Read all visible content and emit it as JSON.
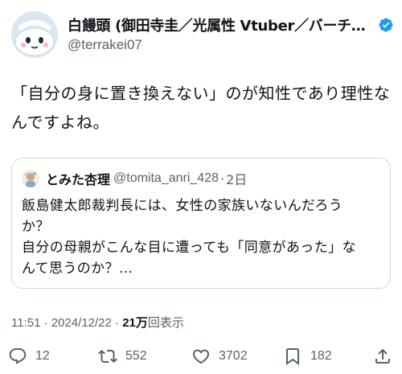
{
  "author": {
    "display_name": "白饅頭 (御田寺圭／光属性 Vtuber／バーチャ…",
    "handle": "@terrakei07",
    "verified_icon": "verified-badge-icon",
    "verified_color": "#1d9bf0"
  },
  "tweet": {
    "text_lines": [
      "「自分の身に置き換えない」のが知性であり理性な",
      "んですよね。"
    ]
  },
  "quote": {
    "display_name": "とみた杏理",
    "handle": "@tomita_anri_428",
    "separator": "·",
    "date": "2日",
    "text_lines": [
      "飯島健太郎裁判長には、女性の家族いないんだろう",
      "か？",
      "自分の母親がこんな目に遭っても「同意があった」な",
      "んて思うのか？..."
    ]
  },
  "meta": {
    "time": "11:51",
    "separator1": "·",
    "date": "2024/12/22",
    "separator2": "·",
    "views_count": "21万",
    "views_label": "回表示"
  },
  "actions": {
    "reply_count": "12",
    "retweet_count": "552",
    "like_count": "3702",
    "bookmark_count": "182",
    "icons": [
      "reply-icon",
      "retweet-icon",
      "like-icon",
      "bookmark-icon",
      "share-icon"
    ]
  }
}
